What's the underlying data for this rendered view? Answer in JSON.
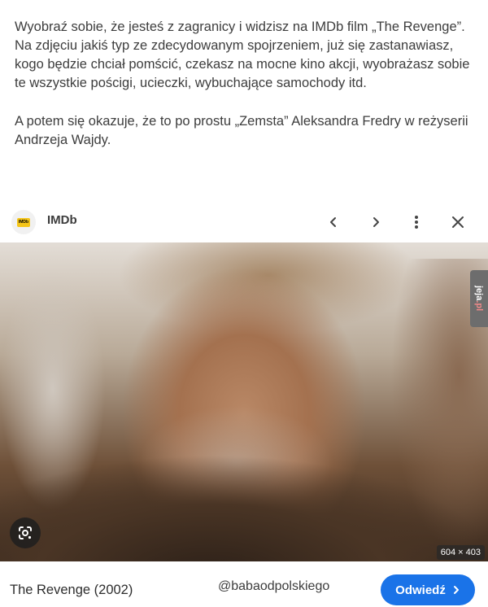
{
  "post": {
    "paragraph1": "Wyobraź sobie, że jesteś z zagranicy i widzisz na IMDb film „The Revenge”. Na zdjęciu jakiś typ ze zdecydowanym spojrzeniem, już się zastanawiasz, kogo będzie chciał pomścić, czekasz na mocne kino akcji, wyobrażasz sobie te wszystkie pościgi, ucieczki, wybuchające samochody itd.",
    "paragraph2": "A potem się okazuje, że to po prostu „Zemsta” Aleksandra Fredry w reżyserii Andrzeja Wajdy."
  },
  "viewer": {
    "site_name": "IMDb",
    "favicon_text": "IMDb",
    "icons": {
      "back": "chevron-left-icon",
      "forward": "chevron-right-icon",
      "more": "more-vertical-icon",
      "close": "close-icon",
      "lens": "google-lens-icon"
    },
    "image_dimensions": "604 × 403",
    "watermark": {
      "text": "jeja",
      "suffix": ".pl"
    }
  },
  "result": {
    "title": "The Revenge (2002)",
    "source_handle": "@babaodpolskiego",
    "visit_label": "Odwiedź",
    "visit_color": "#1a73e8"
  }
}
